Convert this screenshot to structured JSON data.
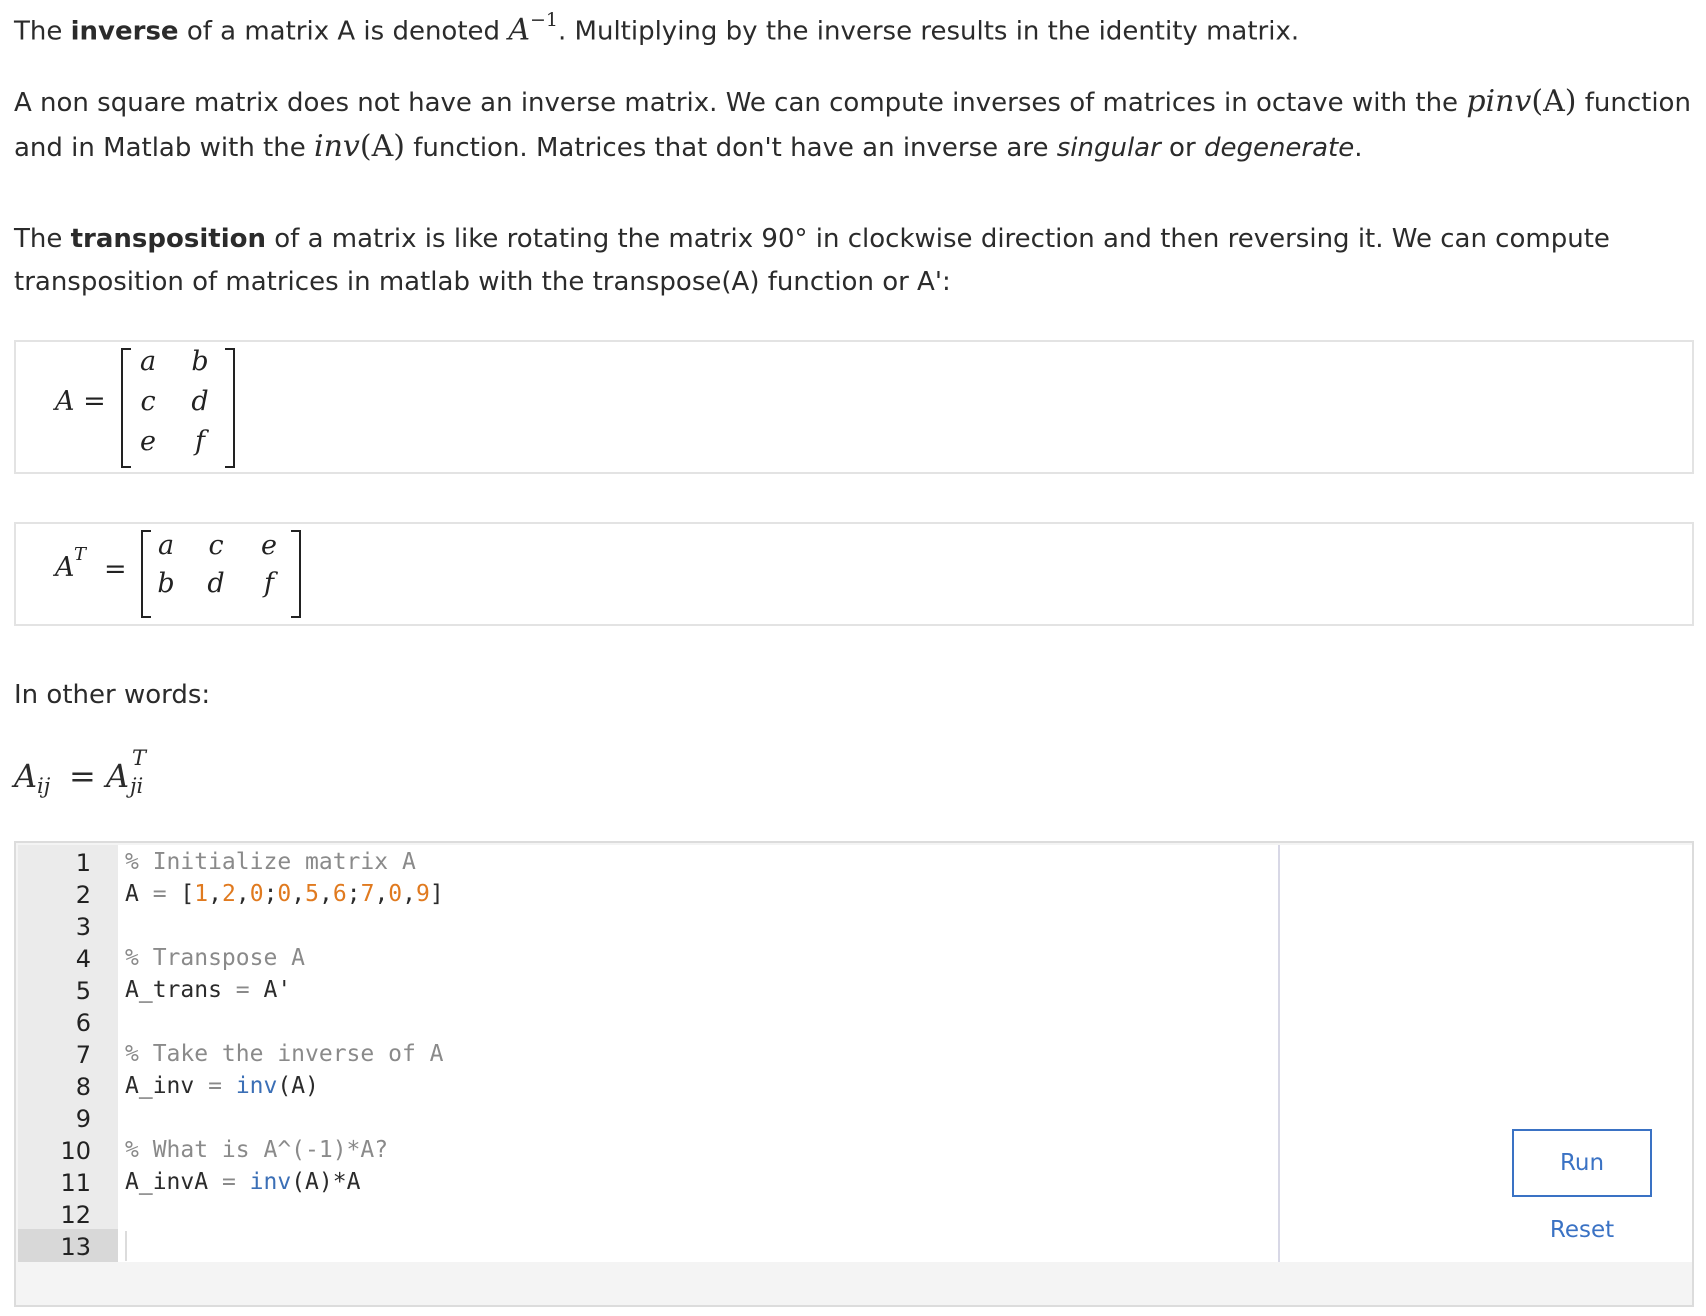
{
  "para1": {
    "t1": "The ",
    "b1": "inverse",
    "t2": " of a matrix A is denoted ",
    "m1": "A",
    "m1sup": "−1",
    "t3": ". Multiplying by the inverse results in the identity matrix."
  },
  "para2": {
    "t1": "A non square matrix does not have an inverse matrix. We can compute inverses of matrices in octave with the ",
    "m1": "pinv",
    "m1arg": "(A)",
    "t2": " function and in Matlab with the ",
    "m2": "inv",
    "m2arg": "(A)",
    "t3": " function. Matrices that don't have an inverse are ",
    "i1": "singular",
    "t4": " or ",
    "i2": "degenerate",
    "t5": "."
  },
  "para3": {
    "t1": "The ",
    "b1": "transposition",
    "t2": " of a matrix is like rotating the matrix 90° in clockwise direction and then reversing it. We can compute transposition of matrices in matlab with the transpose(A) function or A':"
  },
  "matrixA": {
    "label": "A =",
    "rows": [
      [
        "a",
        "b"
      ],
      [
        "c",
        "d"
      ],
      [
        "e",
        "f"
      ]
    ]
  },
  "matrixAT": {
    "label": "A",
    "label_sup": "T",
    "eq": "=",
    "rows": [
      [
        "a",
        "c",
        "e"
      ],
      [
        "b",
        "d",
        "f"
      ]
    ]
  },
  "para4": {
    "text": "In other words:"
  },
  "formula": {
    "lhs": "A",
    "lhs_sub": "ij",
    "eq": "=",
    "rhs": "A",
    "rhs_sup": "T",
    "rhs_sub": "ji"
  },
  "editor": {
    "line_numbers": [
      "1",
      "2",
      "3",
      "4",
      "5",
      "6",
      "7",
      "8",
      "9",
      "10",
      "11",
      "12",
      "13"
    ],
    "lines": {
      "l1": "% Initialize matrix A",
      "l2_a": "A ",
      "l2_eq": "=",
      "l2_sp": " [",
      "l2_n1": "1",
      "l2_c1": ",",
      "l2_n2": "2",
      "l2_c2": ",",
      "l2_n3": "0",
      "l2_s1": ";",
      "l2_n4": "0",
      "l2_c3": ",",
      "l2_n5": "5",
      "l2_c4": ",",
      "l2_n6": "6",
      "l2_s2": ";",
      "l2_n7": "7",
      "l2_c5": ",",
      "l2_n8": "0",
      "l2_c6": ",",
      "l2_n9": "9",
      "l2_end": "]",
      "l4": "% Transpose A",
      "l5_a": "A_trans ",
      "l5_eq": "=",
      "l5_b": " A'",
      "l7": "% Take the inverse of A",
      "l8_a": "A_inv ",
      "l8_eq": "=",
      "l8_sp": " ",
      "l8_fn": "inv",
      "l8_b": "(A)",
      "l10": "% What is A^(-1)*A?",
      "l11_a": "A_invA ",
      "l11_eq": "=",
      "l11_sp": " ",
      "l11_fn": "inv",
      "l11_b": "(A)*A"
    }
  },
  "buttons": {
    "run": "Run",
    "reset": "Reset"
  }
}
